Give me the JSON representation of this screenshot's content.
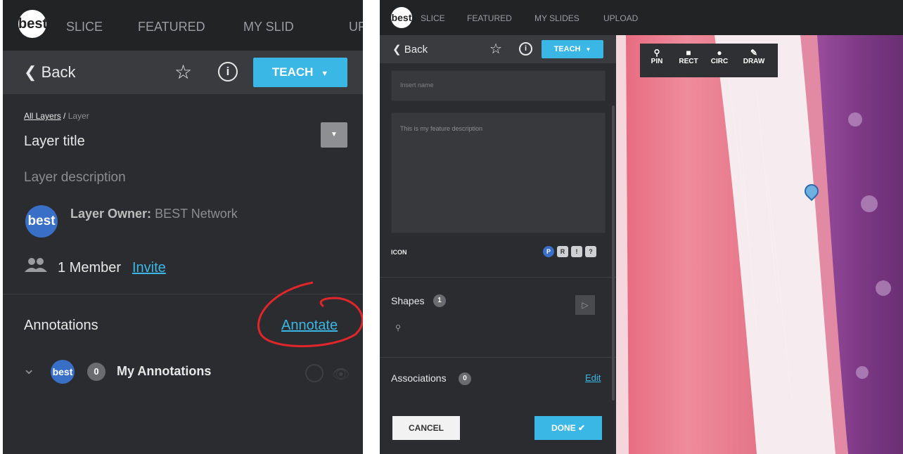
{
  "left": {
    "nav": {
      "logo": "best",
      "items": [
        "SLICE",
        "FEATURED",
        "MY SLID",
        "UP"
      ]
    },
    "toolbar": {
      "back": "Back",
      "teach": "TEACH"
    },
    "breadcrumb": {
      "root": "All Layers",
      "sep": "/",
      "current": "Layer"
    },
    "layer": {
      "title": "Layer title",
      "description": "Layer description"
    },
    "owner": {
      "label": "Layer Owner:",
      "name": "BEST Network",
      "avatar": "best"
    },
    "members": {
      "count_label": "1 Member",
      "invite": "Invite"
    },
    "annotations": {
      "heading": "Annotations",
      "action": "Annotate"
    },
    "my_annotations": {
      "avatar": "best",
      "count": "0",
      "label": "My Annotations"
    }
  },
  "right": {
    "nav": {
      "logo": "best",
      "items": [
        "SLICE",
        "FEATURED",
        "MY SLIDES",
        "UPLOAD"
      ]
    },
    "toolbar": {
      "back": "Back",
      "teach": "TEACH"
    },
    "form": {
      "name_placeholder": "Insert name",
      "description": "This is my feature description",
      "icon_label": "ICON",
      "icon_options": [
        "P",
        "R",
        "!",
        "?"
      ]
    },
    "shapes": {
      "label": "Shapes",
      "count": "1"
    },
    "associations": {
      "label": "Associations",
      "count": "0",
      "edit": "Edit"
    },
    "buttons": {
      "cancel": "CANCEL",
      "done": "DONE"
    },
    "tools": [
      "PIN",
      "RECT",
      "CIRC",
      "DRAW"
    ]
  },
  "colors": {
    "accent": "#3bb7e5",
    "panel": "#2b2c2f",
    "annotation_circle": "#e0262b",
    "tissue_pink": "#e87a8c",
    "tissue_purple": "#7a3a8c"
  }
}
